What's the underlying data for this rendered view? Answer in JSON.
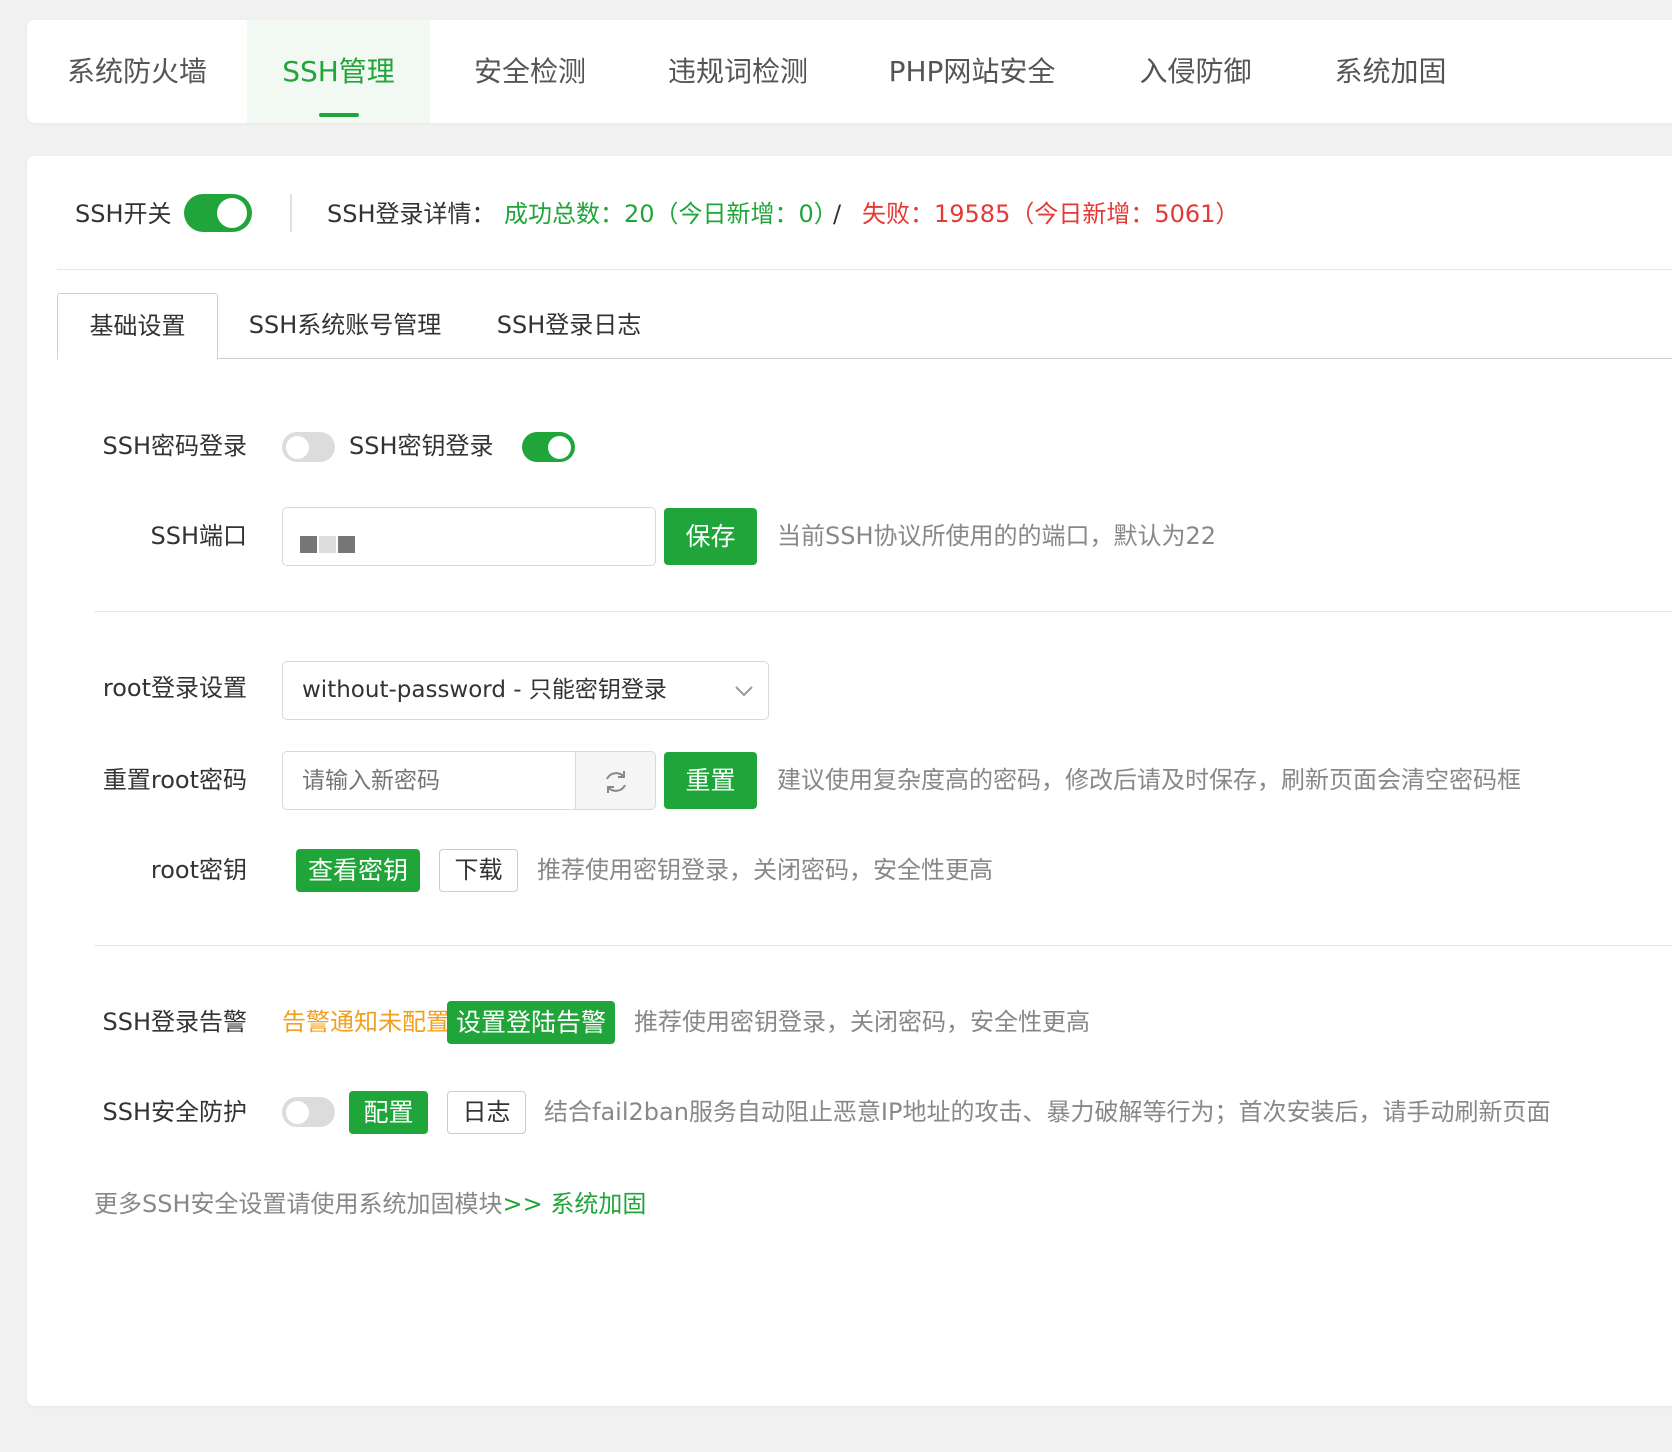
{
  "nav": {
    "tabs": [
      {
        "label": "系统防火墙"
      },
      {
        "label": "SSH管理"
      },
      {
        "label": "安全检测"
      },
      {
        "label": "违规词检测"
      },
      {
        "label": "PHP网站安全"
      },
      {
        "label": "入侵防御"
      },
      {
        "label": "系统加固"
      }
    ],
    "active_index": 1
  },
  "ssh_status": {
    "switch_label": "SSH开关",
    "switch_on": true,
    "details_label": "SSH登录详情：",
    "success_text": "成功总数：20（今日新增：0）",
    "separator": "/",
    "fail_text": "失败：19585（今日新增：5061）"
  },
  "subtabs": [
    {
      "label": "基础设置"
    },
    {
      "label": "SSH系统账号管理"
    },
    {
      "label": "SSH登录日志"
    }
  ],
  "form": {
    "password_login_label": "SSH密码登录",
    "password_login_on": false,
    "key_login_label": "SSH密钥登录",
    "key_login_on": true,
    "port_label": "SSH端口",
    "port_save": "保存",
    "port_hint": "当前SSH协议所使用的的端口，默认为22",
    "root_login_label": "root登录设置",
    "root_login_value": "without-password - 只能密钥登录",
    "reset_pwd_label": "重置root密码",
    "reset_pwd_placeholder": "请输入新密码",
    "reset_btn": "重置",
    "reset_hint": "建议使用复杂度高的密码，修改后请及时保存，刷新页面会清空密码框",
    "root_key_label": "root密钥",
    "view_key_btn": "查看密钥",
    "download_btn": "下载",
    "root_key_hint": "推荐使用密钥登录，关闭密码，安全性更高",
    "alert_label": "SSH登录告警",
    "alert_status": "告警通知未配置",
    "alert_btn": "设置登陆告警",
    "alert_hint": "推荐使用密钥登录，关闭密码，安全性更高",
    "protect_label": "SSH安全防护",
    "protect_on": false,
    "config_btn": "配置",
    "log_btn": "日志",
    "protect_hint": "结合fail2ban服务自动阻止恶意IP地址的攻击、暴力破解等行为；首次安装后，请手动刷新页面",
    "footer_text": "更多SSH安全设置请使用系统加固模块",
    "footer_link": ">> 系统加固"
  },
  "colors": {
    "accent": "#20a53a",
    "fail": "#e53935",
    "warning": "#f0a020"
  }
}
